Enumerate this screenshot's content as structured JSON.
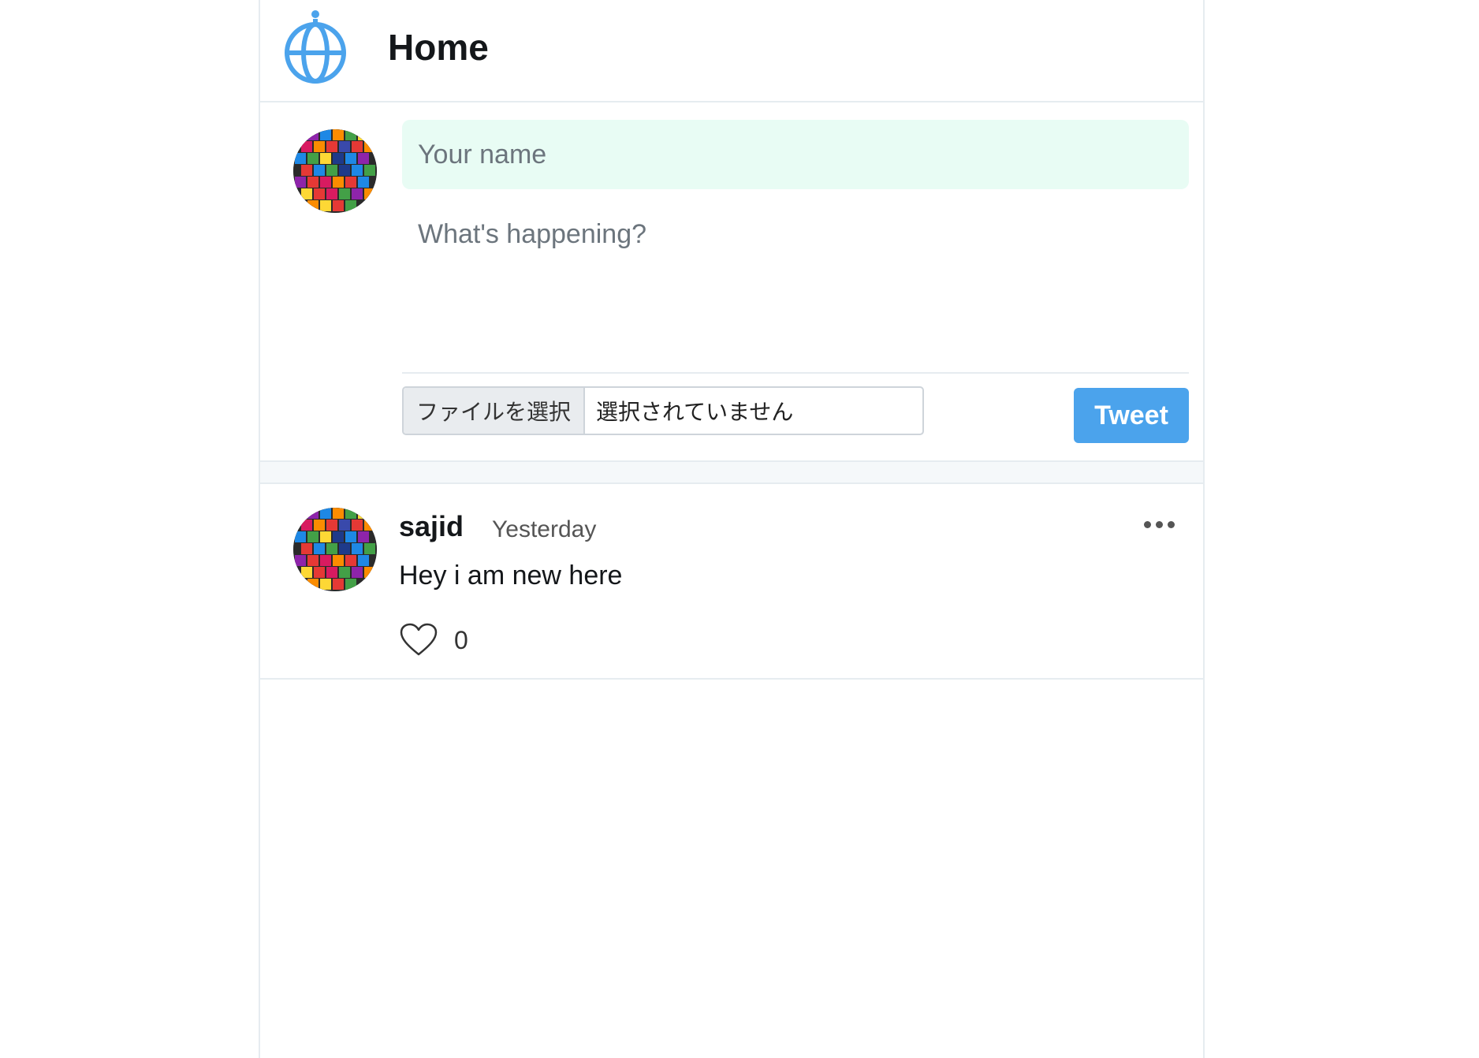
{
  "header": {
    "title": "Home",
    "logo_icon": "globe-icon",
    "logo_color": "#4ba3ec"
  },
  "composer": {
    "name_placeholder": "Your name",
    "name_value": "",
    "tweet_placeholder": "What's happening?",
    "tweet_value": "",
    "file_button_label": "ファイルを選択",
    "file_status": "選択されていません",
    "tweet_button_label": "Tweet",
    "accent_color": "#4ba3ec"
  },
  "feed": {
    "tweets": [
      {
        "author": "sajid",
        "time": "Yesterday",
        "text": "Hey i am new here",
        "likes": "0",
        "more_icon": "more-horizontal-icon",
        "like_icon": "heart-icon"
      }
    ]
  }
}
